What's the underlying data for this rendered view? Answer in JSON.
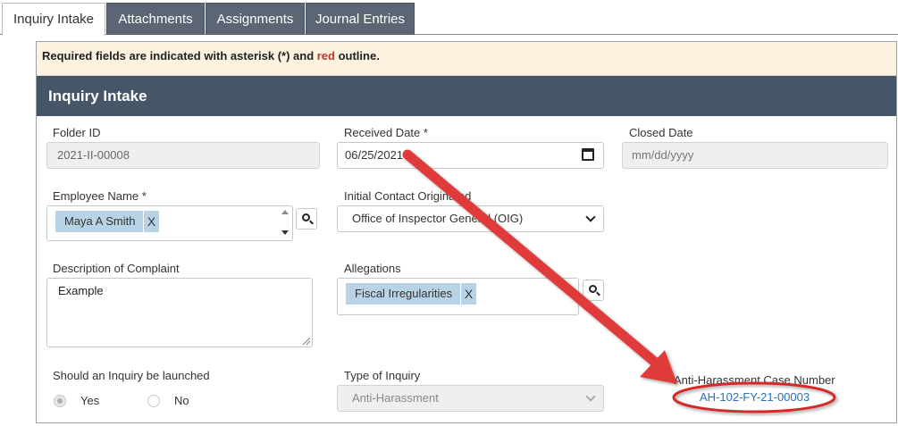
{
  "tabs": [
    {
      "label": "Inquiry Intake"
    },
    {
      "label": "Attachments"
    },
    {
      "label": "Assignments"
    },
    {
      "label": "Journal Entries"
    }
  ],
  "notice": {
    "prefix": "Required fields are indicated with asterisk (*) and ",
    "highlight": "red",
    "suffix": " outline."
  },
  "section": {
    "title": "Inquiry Intake"
  },
  "form": {
    "folder_id": {
      "label": "Folder ID",
      "value": "2021-II-00008"
    },
    "received_date": {
      "label": "Received Date *",
      "value": "06/25/2021"
    },
    "closed_date": {
      "label": "Closed Date",
      "placeholder": "mm/dd/yyyy"
    },
    "employee_name": {
      "label": "Employee Name *",
      "chip": "Maya A Smith",
      "remove": "X"
    },
    "initial_contact": {
      "label": "Initial Contact Originated",
      "value": "Office of Inspector General (OIG)"
    },
    "description": {
      "label": "Description of Complaint",
      "value": "Example"
    },
    "allegations": {
      "label": "Allegations",
      "chip": "Fiscal Irregularities",
      "remove": "X"
    },
    "inquiry_launched": {
      "label": "Should an Inquiry be launched",
      "yes": "Yes",
      "no": "No",
      "selected": "Yes"
    },
    "type_of_inquiry": {
      "label": "Type of Inquiry",
      "value": "Anti-Harassment"
    },
    "case_number": {
      "label": "Anti-Harassment Case Number",
      "value": "AH-102-FY-21-00003"
    }
  },
  "colors": {
    "tab_bg": "#5b6573",
    "header_bg": "#475569",
    "notice_bg": "#fcf2df",
    "chip_bg": "#b9d3e6",
    "annotation_red": "#e03b3b",
    "link": "#2b6fb5"
  }
}
